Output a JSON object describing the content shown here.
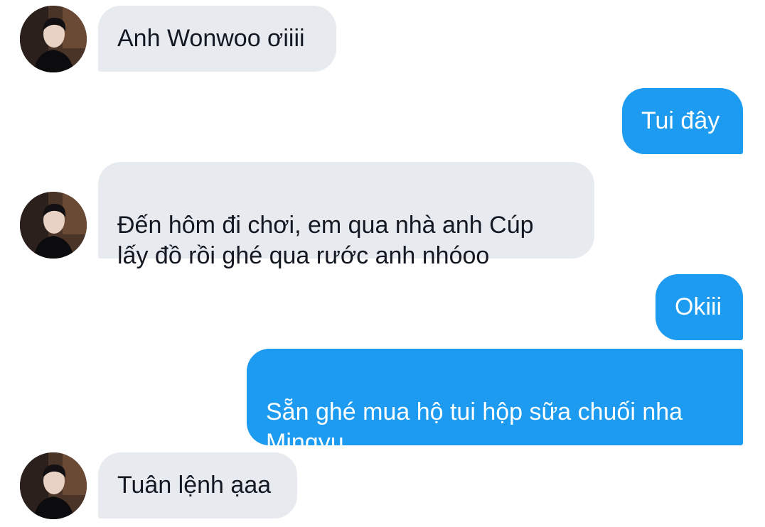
{
  "messages": [
    {
      "id": 1,
      "sender": "contact",
      "text": "Anh Wonwoo ơiiii"
    },
    {
      "id": 2,
      "sender": "me",
      "text": "Tui đây"
    },
    {
      "id": 3,
      "sender": "contact",
      "text": "Đến hôm đi chơi, em qua nhà anh Cúp\nlấy đồ rồi ghé qua rước anh nhóoo"
    },
    {
      "id": 4,
      "sender": "me",
      "text": "Okiii"
    },
    {
      "id": 5,
      "sender": "me",
      "text": "Sẵn ghé mua hộ tui hộp sữa chuối nha\nMingyu"
    },
    {
      "id": 6,
      "sender": "contact",
      "text": "Tuân lệnh ạaa"
    }
  ],
  "colors": {
    "incoming_bubble": "#e7eaee",
    "outgoing_bubble": "#1d9bf0",
    "incoming_text": "#141823",
    "outgoing_text": "#ffffff"
  },
  "icons": {
    "avatar": "contact-avatar-photo"
  }
}
